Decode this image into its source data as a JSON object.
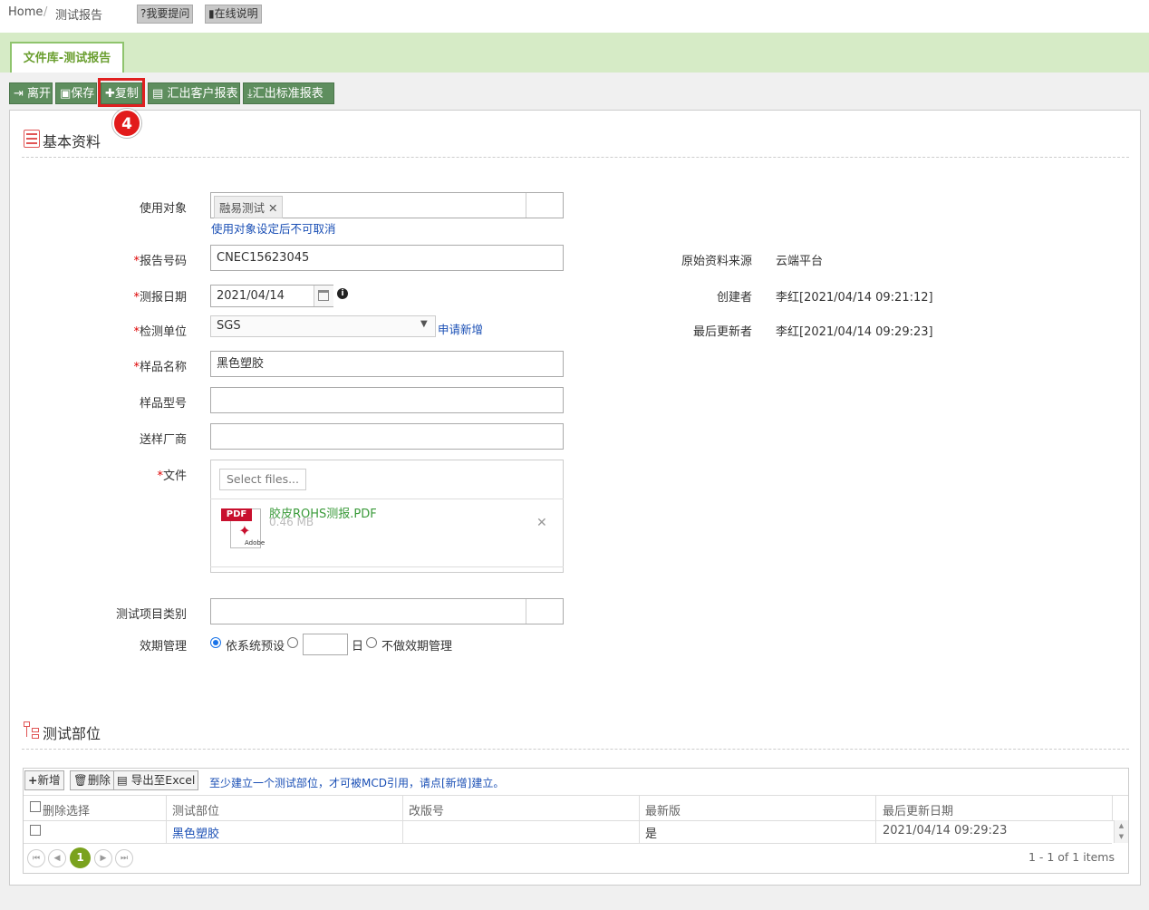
{
  "breadcrumb": {
    "home": "Home",
    "sep": "/",
    "current": "测试报告"
  },
  "help": {
    "ask": "?我要提问",
    "manual": "在线说明"
  },
  "tab": {
    "label": "文件库-测试报告"
  },
  "toolbar": {
    "leave": "离开",
    "save": "保存",
    "copy": "复制",
    "export_customer": "汇出客户报表",
    "export_standard": "汇出标准报表"
  },
  "step_badge": "4",
  "basic": {
    "title": "基本资料",
    "target_label": "使用对象",
    "target_chip": "融易测试",
    "target_hint": "使用对象设定后不可取消",
    "report_no_label": "报告号码",
    "report_no": "CNEC15623045",
    "date_label": "测报日期",
    "date": "2021/04/14",
    "lab_label": "检测单位",
    "lab": "SGS",
    "lab_link": "申请新增",
    "sample_name_label": "样品名称",
    "sample_name": "黑色塑胶",
    "sample_model_label": "样品型号",
    "sample_model": "",
    "vendor_label": "送样厂商",
    "vendor": "",
    "file_label": "文件",
    "select_files": "Select files...",
    "file_name": "胶皮ROHS测报.PDF",
    "file_size": "0.46 MB",
    "test_category_label": "测试项目类别",
    "validity_label": "效期管理",
    "validity_opt1": "依系统预设",
    "validity_days": "",
    "validity_unit": "日",
    "validity_opt3": "不做效期管理",
    "required_mark": "*",
    "pdf_text": "PDF",
    "adobe_text": "Adobe"
  },
  "meta": {
    "source_label": "原始资料来源",
    "source": "云端平台",
    "creator_label": "创建者",
    "creator": "李红[2021/04/14 09:21:12]",
    "updater_label": "最后更新者",
    "updater": "李红[2021/04/14 09:29:23]"
  },
  "parts": {
    "title": "测试部位",
    "add": "新增",
    "delete": "删除",
    "export": "导出至Excel",
    "hint": "至少建立一个测试部位，才可被MCD引用，请点[新增]建立。",
    "columns": [
      "删除选择",
      "测试部位",
      "改版号",
      "最新版",
      "最后更新日期"
    ],
    "rows": [
      {
        "part": "黑色塑胶",
        "rev": "",
        "latest": "是",
        "updated": "2021/04/14 09:29:23"
      }
    ],
    "page": "1",
    "summary": "1 - 1 of 1 items"
  },
  "colors": {
    "toolbar": "#5e8e5e",
    "tab_green": "#6a9e2f",
    "highlight": "#e02020",
    "link": "#1a4fb5"
  }
}
